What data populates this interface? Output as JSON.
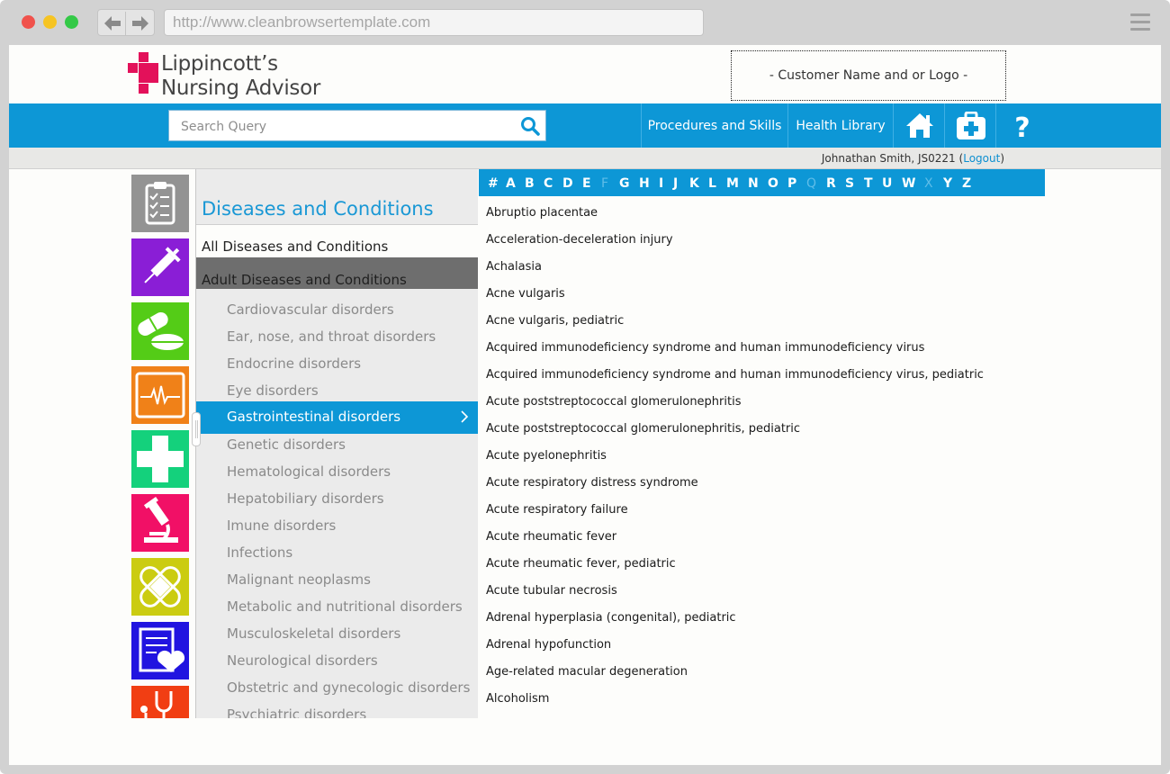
{
  "browser": {
    "url": "http://www.cleanbrowsertemplate.com",
    "back_icon": "arrow-left",
    "forward_icon": "arrow-right"
  },
  "header": {
    "brand_line1": "Lippincott’s",
    "brand_line2": "Nursing Advisor",
    "customer_logo_text": "- Customer Name and or Logo -"
  },
  "colors": {
    "primary_blue": "#0d97d6",
    "brand_pink": "#e3115a",
    "tiles": [
      "#939393",
      "#8a1ed6",
      "#54cc17",
      "#f08118",
      "#14d17c",
      "#f11066",
      "#cbcc11",
      "#2114e0",
      "#f13e13"
    ]
  },
  "nav": {
    "search_placeholder": "Search Query",
    "links": [
      "Procedures and Skills",
      "Health Library"
    ],
    "icons": [
      "home-icon",
      "medical-kit-icon",
      "help-icon"
    ],
    "help_glyph": "?"
  },
  "user": {
    "name": "Johnathan Smith, JS0221",
    "paren_open": "(",
    "logout": "Logout",
    "paren_close": ")"
  },
  "sidebar_icons": [
    "checklist-icon",
    "syringe-icon",
    "pills-icon",
    "heart-monitor-icon",
    "first-aid-cross-icon",
    "microscope-icon",
    "bandage-icon",
    "heart-document-icon",
    "stethoscope-icon"
  ],
  "categories": {
    "heading": "Diseases and Conditions",
    "all": "All Diseases and Conditions",
    "adult": "Adult Diseases and Conditions",
    "items": [
      "Cardiovascular disorders",
      "Ear, nose, and throat disorders",
      "Endocrine disorders",
      "Eye disorders",
      "Gastrointestinal disorders",
      "Genetic disorders",
      "Hematological disorders",
      "Hepatobiliary disorders",
      "Imune disorders",
      "Infections",
      "Malignant neoplasms",
      "Metabolic and nutritional disorders",
      "Musculoskeletal disorders",
      "Neurological disorders",
      "Obstetric and gynecologic disorders",
      "Psychiatric disorders"
    ],
    "active_index": 4
  },
  "alphabet": {
    "letters": [
      "#",
      "A",
      "B",
      "C",
      "D",
      "E",
      "F",
      "G",
      "H",
      "I",
      "J",
      "K",
      "L",
      "M",
      "N",
      "O",
      "P",
      "Q",
      "R",
      "S",
      "T",
      "U",
      "W",
      "X",
      "Y",
      "Z"
    ],
    "disabled": [
      "F",
      "Q",
      "X"
    ]
  },
  "conditions": [
    "Abruptio placentae",
    "Acceleration-deceleration injury",
    "Achalasia",
    "Acne vulgaris",
    "Acne vulgaris, pediatric",
    "Acquired immunodeficiency syndrome and human immunodeficiency virus",
    "Acquired immunodeficiency syndrome and human immunodeficiency virus, pediatric",
    "Acute poststreptococcal glomerulonephritis",
    "Acute poststreptococcal glomerulonephritis, pediatric",
    "Acute pyelonephritis",
    "Acute respiratory distress syndrome",
    "Acute respiratory failure",
    "Acute rheumatic fever",
    "Acute rheumatic fever, pediatric",
    "Acute tubular necrosis",
    "Adrenal hyperplasia (congenital), pediatric",
    "Adrenal hypofunction",
    "Age-related macular degeneration",
    "Alcoholism"
  ]
}
